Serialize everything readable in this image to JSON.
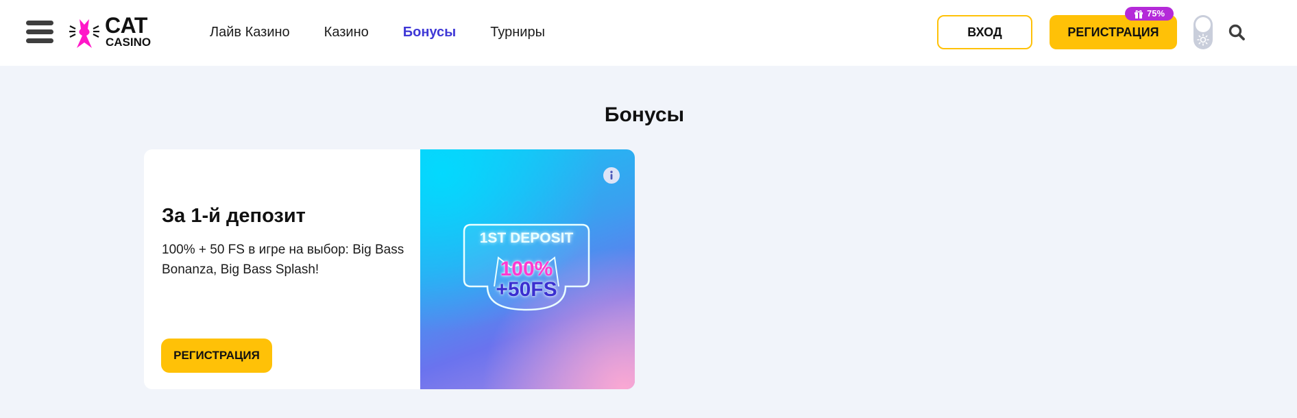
{
  "header": {
    "logo": {
      "line1": "CAT",
      "line2": "CASINO"
    },
    "nav": [
      {
        "label": "Лайв Казино"
      },
      {
        "label": "Казино"
      },
      {
        "label": "Бонусы"
      },
      {
        "label": "Турниры"
      }
    ],
    "active_nav": "Бонусы",
    "login_label": "ВХОД",
    "register_label": "РЕГИСТРАЦИЯ",
    "register_badge": "75%",
    "icons": [
      "menu-icon",
      "gift-icon",
      "sun-icon",
      "search-icon"
    ]
  },
  "main": {
    "title": "Бонусы",
    "bonus_card": {
      "title": "За 1-й депозит",
      "description": "100% + 50 FS в игре на выбор: Big Bass Bonanza, Big Bass Splash!",
      "button_label": "РЕГИСТРАЦИЯ",
      "image": {
        "heading": "1ST DEPOSIT",
        "percent": "100%",
        "spins": "+50FS"
      }
    }
  },
  "colors": {
    "accent_yellow": "#ffc107",
    "nav_active": "#3f38d6",
    "badge_purple": "#b42ad8",
    "page_bg": "#f1f4fa"
  }
}
